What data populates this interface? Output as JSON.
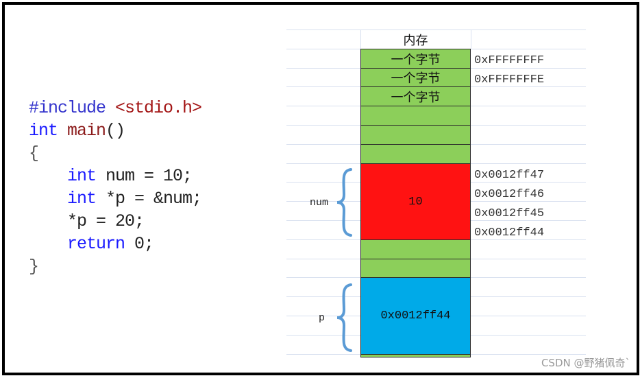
{
  "code": {
    "lines": [
      {
        "parts": [
          {
            "t": "#include ",
            "c": "pp"
          },
          {
            "t": "<stdio.h>",
            "c": "inc"
          }
        ]
      },
      {
        "parts": [
          {
            "t": "int ",
            "c": "kw"
          },
          {
            "t": "main",
            "c": "fn"
          },
          {
            "t": "()",
            "c": "plain"
          }
        ]
      },
      {
        "parts": [
          {
            "t": "{",
            "c": "brace"
          }
        ]
      },
      {
        "parts": [
          {
            "t": "    "
          },
          {
            "t": "int ",
            "c": "kw"
          },
          {
            "t": "num = 10;",
            "c": "plain"
          }
        ]
      },
      {
        "parts": [
          {
            "t": "    "
          },
          {
            "t": "int ",
            "c": "kw"
          },
          {
            "t": "*p = &num;",
            "c": "plain"
          }
        ]
      },
      {
        "parts": [
          {
            "t": "    "
          },
          {
            "t": "*p = 20;",
            "c": "plain"
          }
        ]
      },
      {
        "parts": [
          {
            "t": "    "
          },
          {
            "t": "return ",
            "c": "kw"
          },
          {
            "t": "0;",
            "c": "plain"
          }
        ]
      },
      {
        "parts": [
          {
            "t": "}",
            "c": "brace"
          }
        ]
      }
    ]
  },
  "memory": {
    "header": "内存",
    "byte_label": "一个字节",
    "cells": [
      {
        "type": "green",
        "label": "一个字节"
      },
      {
        "type": "green",
        "label": "一个字节"
      },
      {
        "type": "green",
        "label": "一个字节"
      },
      {
        "type": "green",
        "label": ""
      },
      {
        "type": "green",
        "label": ""
      },
      {
        "type": "green",
        "label": ""
      },
      {
        "type": "red",
        "label": "10",
        "rows": 4
      },
      {
        "type": "green",
        "label": ""
      },
      {
        "type": "green",
        "label": ""
      },
      {
        "type": "blue",
        "label": "0x0012ff44",
        "rows": 4
      }
    ],
    "addresses_top": [
      "0xFFFFFFFF",
      "0xFFFFFFFE"
    ],
    "addresses_num": [
      "0x0012ff47",
      "0x0012ff46",
      "0x0012ff45",
      "0x0012ff44"
    ],
    "variables": [
      {
        "name": "num"
      },
      {
        "name": "p"
      }
    ],
    "colors": {
      "green": "#8ccf5a",
      "red": "#ff1212",
      "blue": "#00aae8",
      "brace": "#5b9bd5"
    }
  },
  "watermark": "CSDN @野猪佩奇`"
}
